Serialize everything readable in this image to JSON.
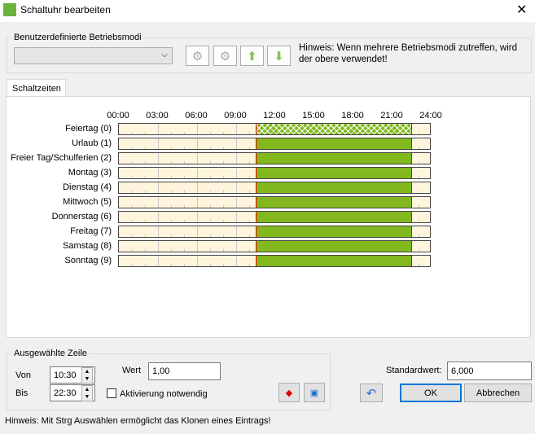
{
  "window": {
    "title": "Schaltuhr bearbeiten",
    "close": "✕"
  },
  "modes": {
    "legend": "Benutzerdefinierte Betriebsmodi",
    "select_value": "",
    "hint": "Hinweis: Wenn mehrere Betriebsmodi zutreffen, wird der obere verwendet!",
    "buttons": [
      "add-mode",
      "delete-mode",
      "move-up",
      "move-down"
    ]
  },
  "tabs": [
    {
      "label": "Schaltzeiten",
      "active": true
    }
  ],
  "schedule": {
    "hour_range": [
      0,
      24
    ],
    "time_labels": [
      "00:00",
      "03:00",
      "06:00",
      "09:00",
      "12:00",
      "15:00",
      "18:00",
      "21:00",
      "24:00"
    ],
    "colors": {
      "active": "#82b81e",
      "background": "#fff5dc",
      "edge": "#ee0000"
    },
    "rows": [
      {
        "label": "Feiertag (0)",
        "segments": [
          {
            "start": 10.5,
            "end": 22.5,
            "hatched": true
          }
        ]
      },
      {
        "label": "Urlaub (1)",
        "segments": [
          {
            "start": 10.5,
            "end": 22.5
          }
        ]
      },
      {
        "label": "Freier Tag/Schulferien (2)",
        "segments": [
          {
            "start": 10.5,
            "end": 22.5
          }
        ]
      },
      {
        "label": "Montag (3)",
        "segments": [
          {
            "start": 10.5,
            "end": 22.5
          }
        ]
      },
      {
        "label": "Dienstag (4)",
        "segments": [
          {
            "start": 10.5,
            "end": 22.5
          }
        ]
      },
      {
        "label": "Mittwoch (5)",
        "segments": [
          {
            "start": 10.5,
            "end": 22.5
          }
        ]
      },
      {
        "label": "Donnerstag (6)",
        "segments": [
          {
            "start": 10.5,
            "end": 22.5
          }
        ]
      },
      {
        "label": "Freitag (7)",
        "segments": [
          {
            "start": 10.5,
            "end": 22.5
          }
        ]
      },
      {
        "label": "Samstag (8)",
        "segments": [
          {
            "start": 10.5,
            "end": 22.5
          }
        ]
      },
      {
        "label": "Sonntag (9)",
        "segments": [
          {
            "start": 10.5,
            "end": 22.5
          }
        ]
      }
    ]
  },
  "selected": {
    "legend": "Ausgewählte Zeile",
    "von_label": "Von",
    "von": "10:30",
    "bis_label": "Bis",
    "bis": "22:30",
    "wert_label": "Wert",
    "wert": "1,00",
    "activation_label": "Aktivierung notwendig",
    "activation_checked": false
  },
  "standard": {
    "label": "Standardwert:",
    "value": "6,000"
  },
  "footer": {
    "ok": "OK",
    "cancel": "Abbrechen",
    "hint": "Hinweis: Mit Strg Auswählen ermöglicht das Klonen eines Eintrags!"
  }
}
